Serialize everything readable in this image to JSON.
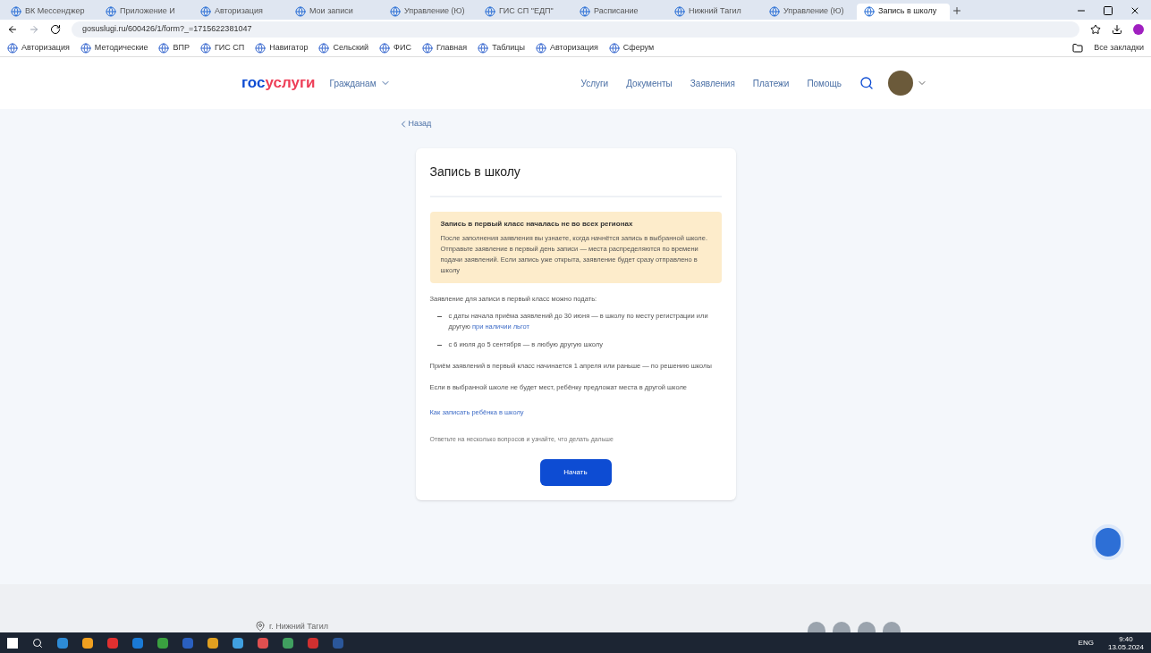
{
  "browser": {
    "tabs": [
      {
        "title": "ВК Мессенджер",
        "selected": false
      },
      {
        "title": "Приложение И",
        "selected": false
      },
      {
        "title": "Авторизация",
        "selected": false
      },
      {
        "title": "Мои записи",
        "selected": false
      },
      {
        "title": "Управление (Ю)",
        "selected": false
      },
      {
        "title": "ГИС СП \"ЕДП\"",
        "selected": false
      },
      {
        "title": "Расписание",
        "selected": false
      },
      {
        "title": "Нижний Тагил",
        "selected": false
      },
      {
        "title": "Управление (Ю)",
        "selected": false
      },
      {
        "title": "Запись в школу",
        "selected": true
      }
    ],
    "url": "gosuslugi.ru/600426/1/form?_=1715622381047",
    "bookmarks": [
      "Авторизация",
      "Методические",
      "ВПР",
      "ГИС СП",
      "Навигатор",
      "Сельский",
      "ФИС",
      "Главная",
      "Таблицы",
      "Авторизация",
      "Сферум"
    ],
    "other_bookmarks": "Все закладки"
  },
  "header": {
    "logo_a": "гос",
    "logo_b": "услуги",
    "audience": "Гражданам",
    "nav": [
      "Услуги",
      "Документы",
      "Заявления",
      "Платежи",
      "Помощь"
    ]
  },
  "back": "Назад",
  "card": {
    "title": "Запись в школу",
    "notice": {
      "title": "Запись в первый класс началась не во всех регионах",
      "text": "После заполнения заявления вы узнаете, когда начнётся запись в выбранной школе. Отправьте заявление в первый день записи — места распределяются по времени подачи заявлений. Если запись уже открыта, заявление будет сразу отправлено в школу"
    },
    "intro": "Заявление для записи в первый класс можно подать:",
    "bullets": [
      {
        "text": "с даты начала приёма заявлений до 30 июня — в школу по месту регистрации или другую",
        "link": "при наличии льгот"
      },
      {
        "text": "с 6 июля до 5 сентября — в любую другую школу"
      }
    ],
    "paragraphs": [
      "Приём заявлений в первый класс начинается 1 апреля или раньше — по решению школы",
      "Если в выбранной школе не будет мест, ребёнку предложат места в другой школе"
    ],
    "link": "Как записать ребёнка в школу",
    "hint": "Ответьте на несколько вопросов и узнайте, что делать дальше",
    "button": "Начать"
  },
  "footer": {
    "city": "г. Нижний Тагил"
  },
  "taskbar": {
    "time": "9:40",
    "date": "13.05.2024",
    "lang": "ENG"
  }
}
